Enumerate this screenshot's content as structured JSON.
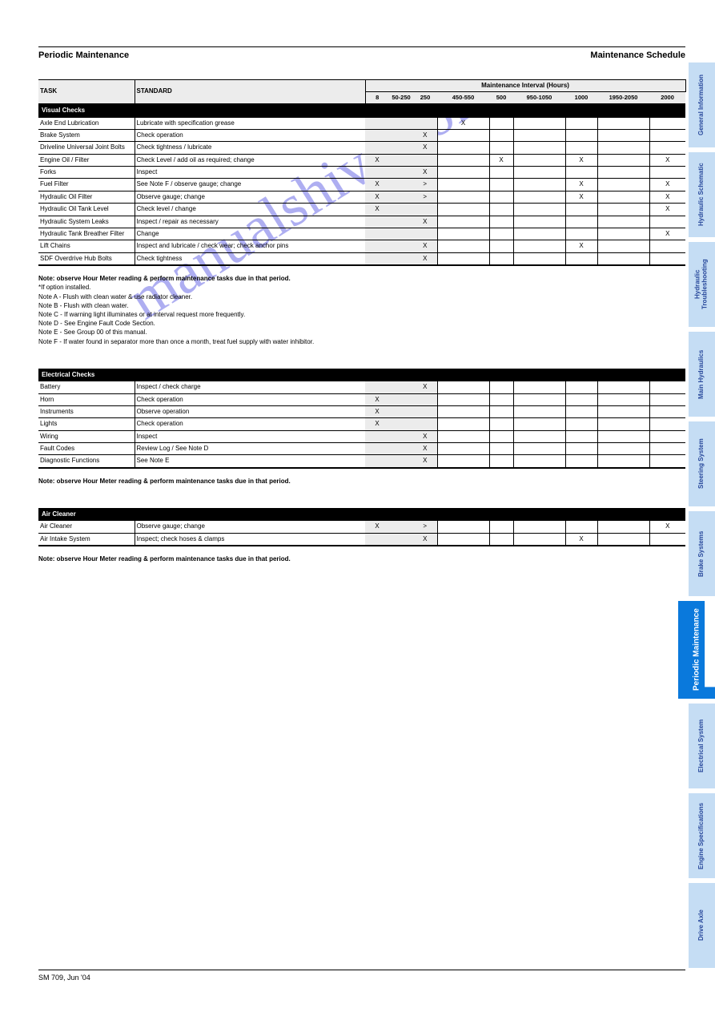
{
  "header": {
    "left": "Periodic Maintenance",
    "right": "Maintenance Schedule"
  },
  "footer": "SM 709, Jun '04",
  "watermark": "manualshive.com",
  "tabs": [
    "General Information",
    "Hydraulic Schematic",
    "Hydraulic Troubleshooting",
    "Main Hydraulics",
    "Steering System",
    "Brake Systems",
    "Periodic Maintenance",
    "Electrical System",
    "Engine Specifications",
    "Drive Axle"
  ],
  "tabs_active_index": 6,
  "cols": {
    "spgrp": "Maintenance Interval (Hours)",
    "s": [
      "8",
      "50-250",
      "250",
      "450-550",
      "500",
      "950-1050",
      "1000",
      "1950-2050",
      "2000"
    ]
  },
  "table1": {
    "header": {
      "task": "TASK",
      "standard": "STANDARD"
    },
    "section": "Visual Checks",
    "rows": [
      {
        "t": "Axle End Lubrication",
        "s": "Lubricate with specification grease",
        "m": [
          "",
          "",
          "",
          "X",
          "",
          "",
          "",
          "",
          ""
        ]
      },
      {
        "t": "Brake System",
        "s": "Check operation",
        "m": [
          "",
          "",
          "X",
          "",
          "",
          "",
          "",
          "",
          ""
        ]
      },
      {
        "t": "Driveline Universal Joint Bolts",
        "s": "Check tightness / lubricate",
        "m": [
          "",
          "",
          "X",
          "",
          "",
          "",
          "",
          "",
          ""
        ]
      },
      {
        "t": "Engine Oil / Filter",
        "s": "Check Level / add oil as required; change",
        "m": [
          "X",
          "",
          "",
          "",
          "X",
          "",
          "X",
          "",
          "X"
        ]
      },
      {
        "t": "Forks",
        "s": "Inspect",
        "m": [
          "",
          "",
          "X",
          "",
          "",
          "",
          "",
          "",
          ""
        ]
      },
      {
        "t": "Fuel Filter",
        "s": "See Note F / observe gauge; change",
        "m": [
          "X",
          "",
          ">",
          "",
          "",
          "",
          "X",
          "",
          "X"
        ]
      },
      {
        "t": "Hydraulic Oil Filter",
        "s": "Observe gauge; change",
        "m": [
          "X",
          "",
          ">",
          "",
          "",
          "",
          "X",
          "",
          "X"
        ]
      },
      {
        "t": "Hydraulic Oil Tank Level",
        "s": "Check level / change",
        "m": [
          "X",
          "",
          "",
          "",
          "",
          "",
          "",
          "",
          "X"
        ]
      },
      {
        "t": "Hydraulic System Leaks",
        "s": "Inspect / repair as necessary",
        "m": [
          "",
          "",
          "X",
          "",
          "",
          "",
          "",
          "",
          ""
        ]
      },
      {
        "t": "Hydraulic Tank Breather Filter",
        "s": "Change",
        "m": [
          "",
          "",
          "",
          "",
          "",
          "",
          "",
          "",
          "X"
        ]
      },
      {
        "t": "Lift Chains",
        "s": "Inspect and lubricate / check wear; check anchor pins",
        "m": [
          "",
          "",
          "X",
          "",
          "",
          "",
          "X",
          "",
          ""
        ]
      },
      {
        "t": "SDF Overdrive Hub Bolts",
        "s": "Check tightness",
        "m": [
          "",
          "",
          "X",
          "",
          "",
          "",
          "",
          "",
          ""
        ]
      }
    ],
    "notes": [
      "*If option installed.",
      "Note A - Flush with clean water & use radiator cleaner.",
      "Note B - Flush with clean water.",
      "Note C - If warning light illuminates or at interval request more frequently.",
      "Note D - See Engine Fault Code Section.",
      "Note E - See Group 00 of this manual.",
      "Note F - If water found in separator more than once a month, treat fuel supply with water inhibitor."
    ],
    "notes_bold_title": "Note: observe Hour Meter reading & perform maintenance tasks due in that period."
  },
  "table2": {
    "section": "Electrical Checks",
    "rows": [
      {
        "t": "Battery",
        "s": "Inspect / check charge",
        "m": [
          "",
          "",
          "X",
          "",
          "",
          "",
          "",
          "",
          ""
        ]
      },
      {
        "t": "Horn",
        "s": "Check operation",
        "m": [
          "X",
          "",
          "",
          "",
          "",
          "",
          "",
          "",
          ""
        ]
      },
      {
        "t": "Instruments",
        "s": "Observe operation",
        "m": [
          "X",
          "",
          "",
          "",
          "",
          "",
          "",
          "",
          ""
        ]
      },
      {
        "t": "Lights",
        "s": "Check operation",
        "m": [
          "X",
          "",
          "",
          "",
          "",
          "",
          "",
          "",
          ""
        ]
      },
      {
        "t": "Wiring",
        "s": "Inspect",
        "m": [
          "",
          "",
          "X",
          "",
          "",
          "",
          "",
          "",
          ""
        ]
      },
      {
        "t": "Fault Codes",
        "s": "Review Log / See Note D",
        "m": [
          "",
          "",
          "X",
          "",
          "",
          "",
          "",
          "",
          ""
        ]
      },
      {
        "t": "Diagnostic Functions",
        "s": "See Note E",
        "m": [
          "",
          "",
          "X",
          "",
          "",
          "",
          "",
          "",
          ""
        ]
      }
    ],
    "notes_bold_title": "Note: observe Hour Meter reading & perform maintenance tasks due in that period."
  },
  "table3": {
    "section": "Air Cleaner",
    "rows": [
      {
        "t": "Air Cleaner",
        "s": "Observe gauge; change",
        "m": [
          "X",
          "",
          ">",
          "",
          "",
          "",
          "",
          "",
          "X"
        ]
      },
      {
        "t": "Air Intake System",
        "s": "Inspect; check hoses & clamps",
        "m": [
          "",
          "",
          "X",
          "",
          "",
          "",
          "X",
          "",
          ""
        ]
      }
    ],
    "notes_bold_title": "Note: observe Hour Meter reading & perform maintenance tasks due in that period."
  },
  "maintnotes": ""
}
